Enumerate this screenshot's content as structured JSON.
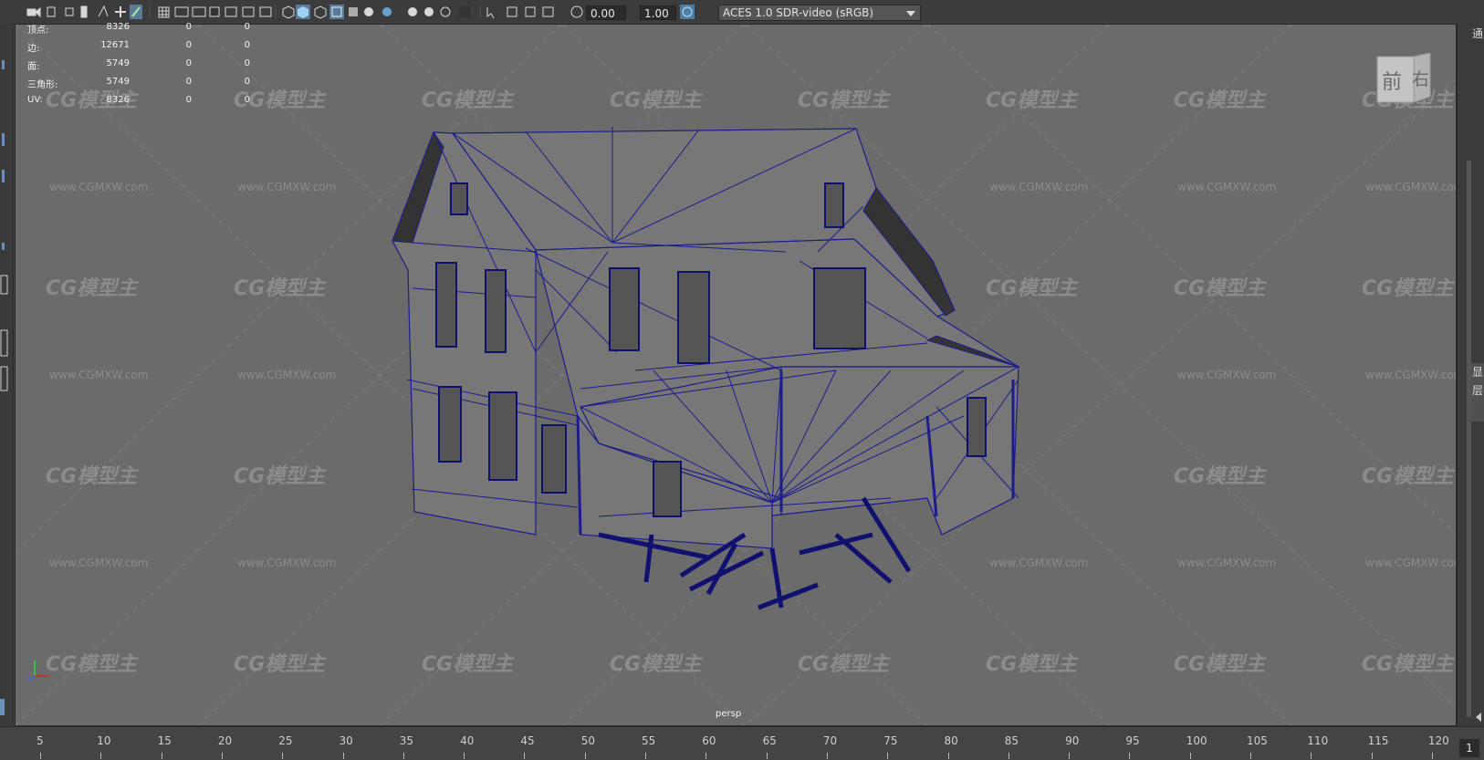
{
  "toolbar": {
    "exposure": "0.00",
    "gamma": "1.00",
    "color_space": "ACES 1.0 SDR-video (sRGB)"
  },
  "hud": {
    "rows": [
      {
        "label": "顶点:",
        "v1": "8326",
        "v2": "0",
        "v3": "0"
      },
      {
        "label": "边:",
        "v1": "12671",
        "v2": "0",
        "v3": "0"
      },
      {
        "label": "面:",
        "v1": "5749",
        "v2": "0",
        "v3": "0"
      },
      {
        "label": "三角形:",
        "v1": "5749",
        "v2": "0",
        "v3": "0"
      },
      {
        "label": "UV:",
        "v1": "8326",
        "v2": "0",
        "v3": "0"
      }
    ]
  },
  "viewport": {
    "camera": "persp",
    "viewcube": {
      "front": "前",
      "right": "右"
    },
    "watermark_logo": "CG模型主",
    "watermark_url": "www.CGMXW.com",
    "wireframe_color": "#1c1c8c"
  },
  "side_panel": {
    "top_char": "通",
    "tab1": "显",
    "tab2": "层"
  },
  "timeline": {
    "ticks": [
      "5",
      "10",
      "15",
      "20",
      "25",
      "30",
      "35",
      "40",
      "45",
      "50",
      "55",
      "60",
      "65",
      "70",
      "75",
      "80",
      "85",
      "90",
      "95",
      "100",
      "105",
      "110",
      "115",
      "120"
    ],
    "current_frame": "1"
  }
}
